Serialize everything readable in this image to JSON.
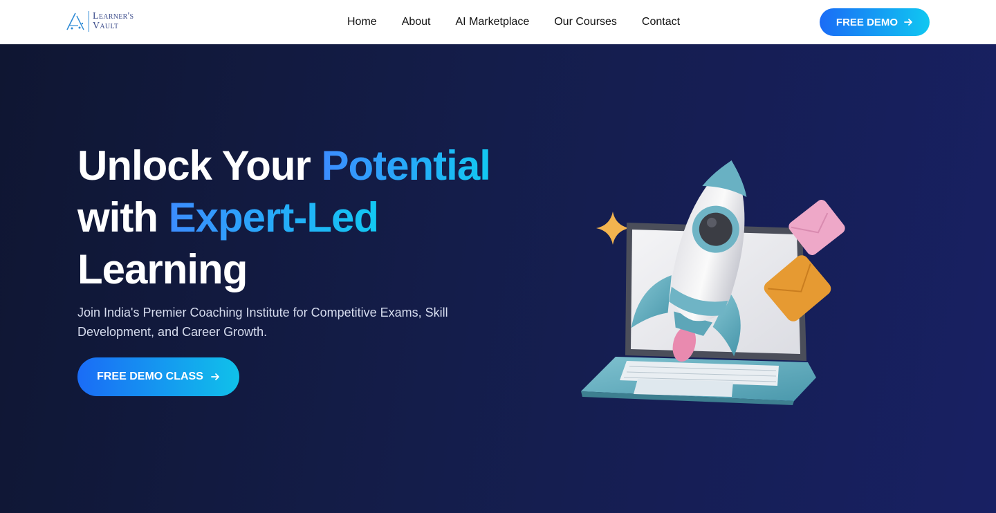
{
  "header": {
    "logo": {
      "line1": "Learner's",
      "line2": "Vault"
    },
    "nav": [
      "Home",
      "About",
      "AI Marketplace",
      "Our Courses",
      "Contact"
    ],
    "demo_button": "FREE DEMO"
  },
  "hero": {
    "title_part1": "Unlock Your ",
    "title_highlight1": "Potential",
    "title_part2": "with ",
    "title_highlight2": "Expert-Led",
    "title_part3": "Learning",
    "subtitle": "Join India's Premier Coaching Institute for Competitive Exams, Skill Development, and Career Growth.",
    "cta_label": "FREE DEMO CLASS"
  },
  "icons": {
    "arrow": "arrow-right-icon",
    "illustration": "rocket-laptop-illustration"
  },
  "colors": {
    "hero_bg": "#141d4a",
    "accent_start": "#1a6cf6",
    "accent_end": "#10c7f1",
    "nav_text": "#111111"
  }
}
